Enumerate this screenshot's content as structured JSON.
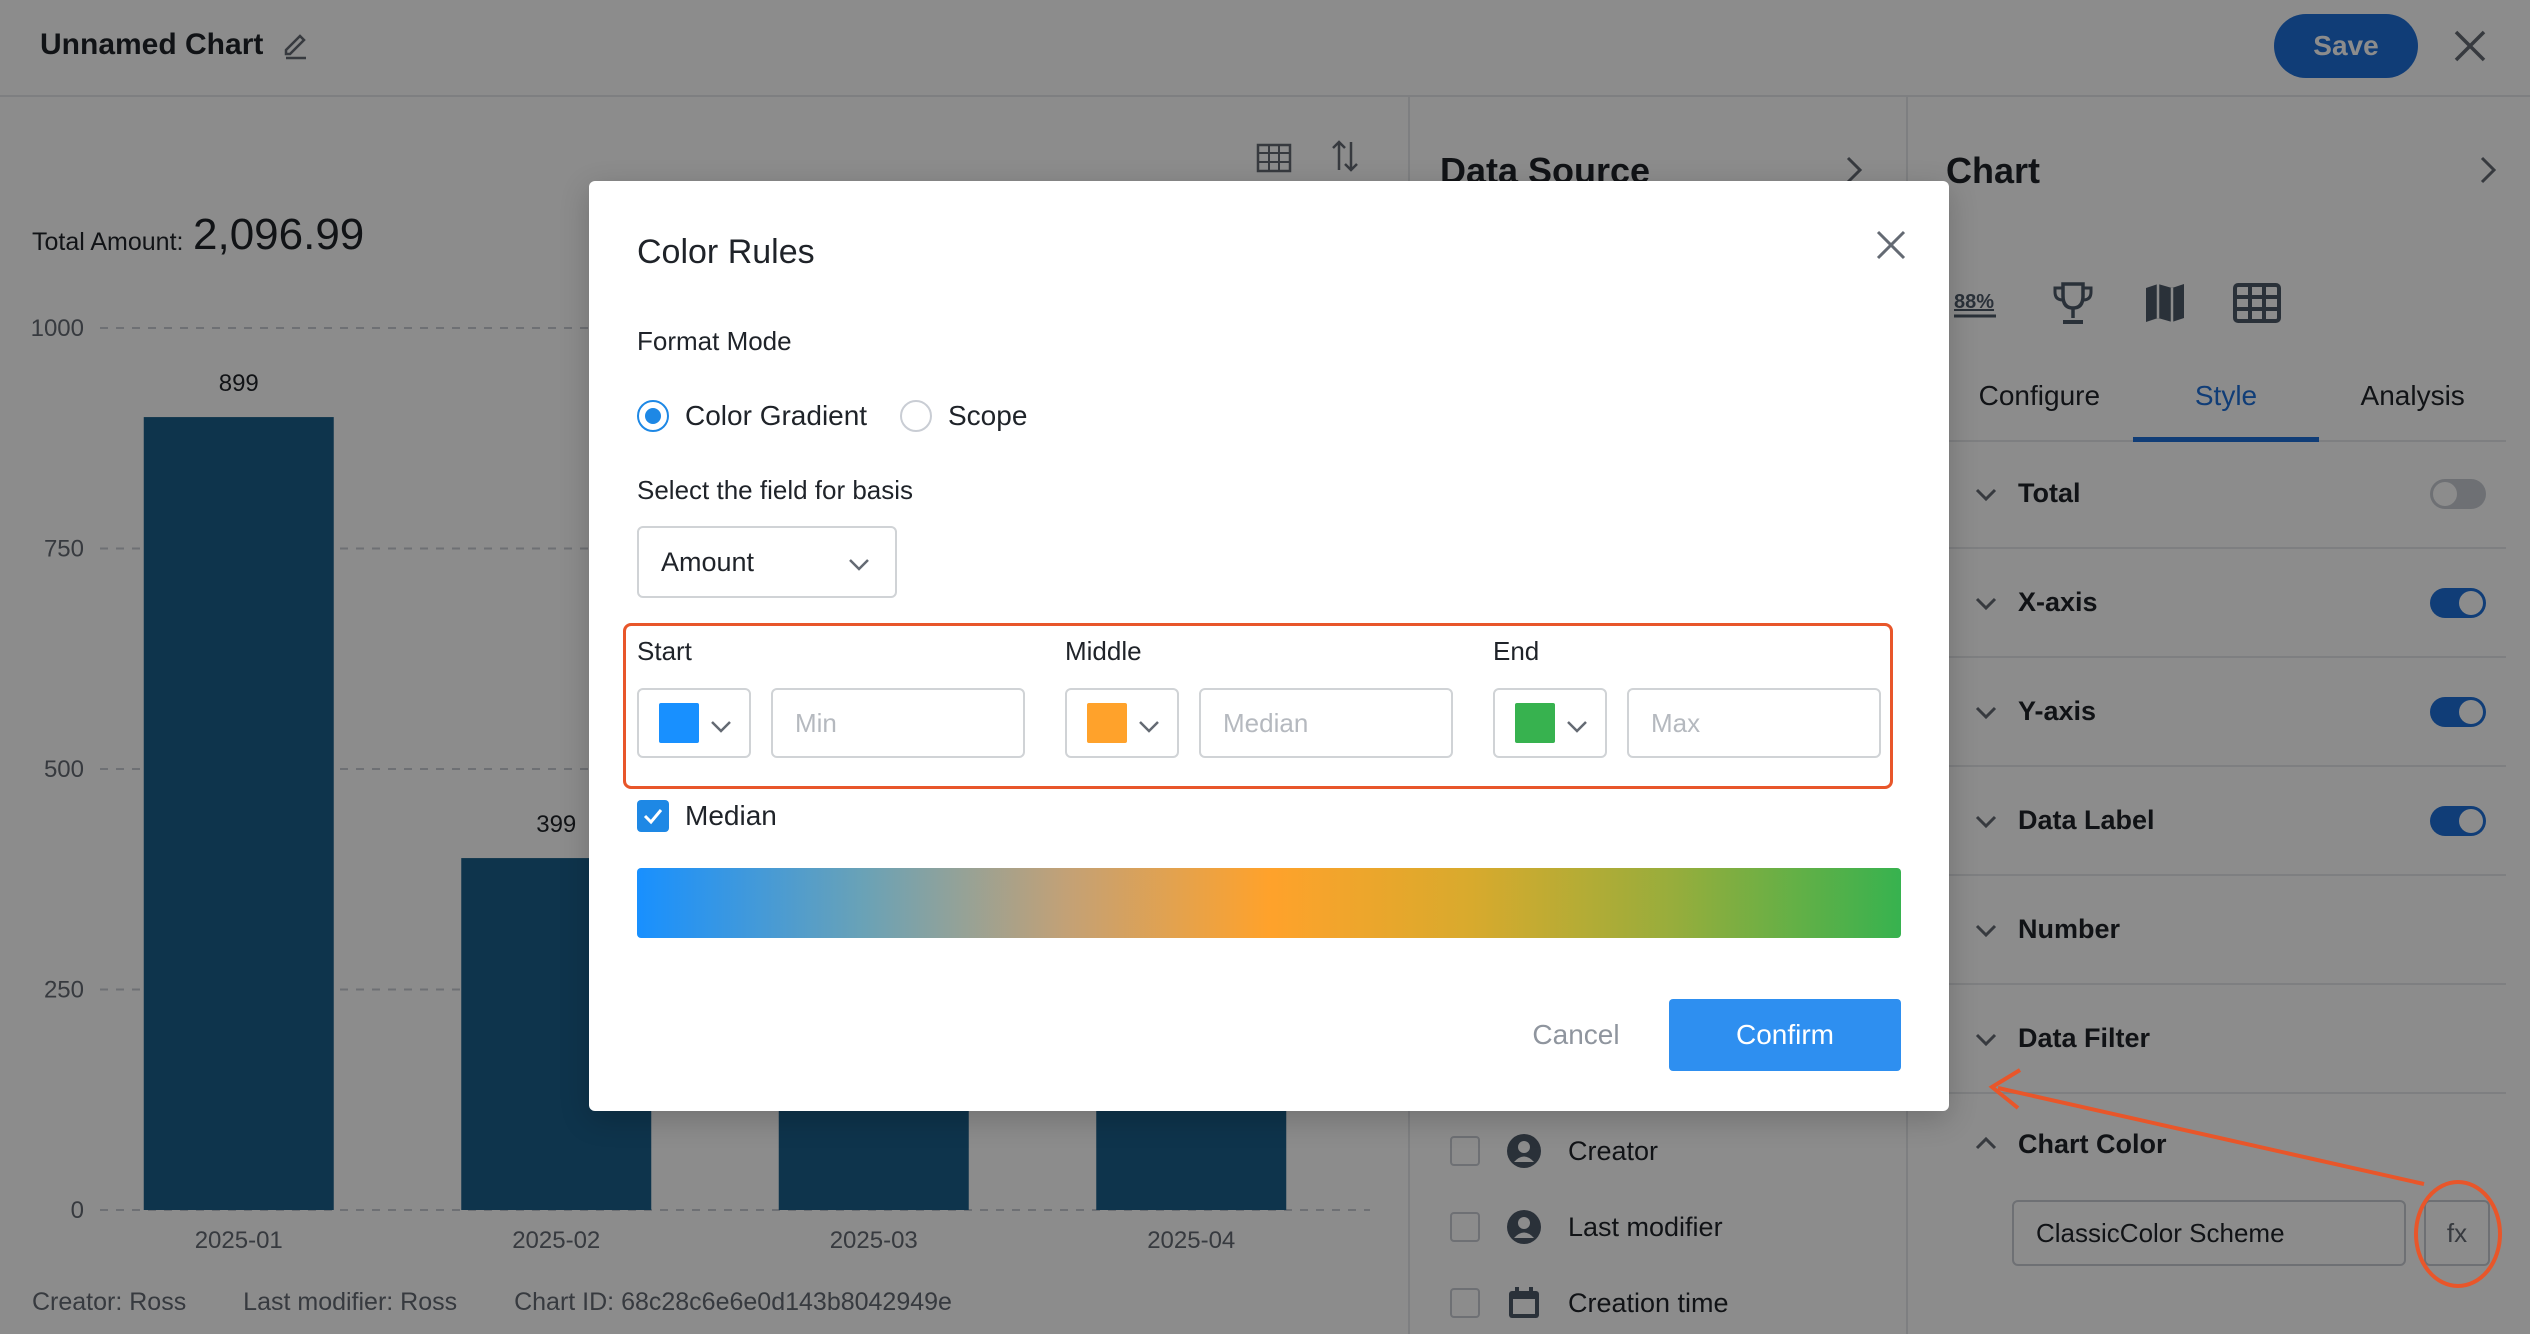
{
  "header": {
    "title": "Unnamed Chart",
    "save_label": "Save"
  },
  "chart_panel": {
    "total_label": "Total Amount:",
    "total_value": "2,096.99",
    "footer": {
      "creator": "Creator: Ross",
      "last_modifier": "Last modifier: Ross",
      "chart_id": "Chart ID: 68c28c6e6e0d143b8042949e"
    }
  },
  "chart_data": {
    "type": "bar",
    "categories": [
      "2025-01",
      "2025-02",
      "2025-03",
      "2025-04"
    ],
    "values": [
      899,
      399,
      400,
      399
    ],
    "data_labels": [
      "899",
      "399",
      "",
      ""
    ],
    "ylim": [
      0,
      1000
    ],
    "yticks": [
      0,
      250,
      500,
      750,
      1000
    ],
    "bar_color": "#1a5f8a",
    "grid": true
  },
  "data_source": {
    "title": "Data Source",
    "fields": [
      {
        "label": "Creator",
        "icon": "user-icon"
      },
      {
        "label": "Last modifier",
        "icon": "user-icon"
      },
      {
        "label": "Creation time",
        "icon": "calendar-icon"
      }
    ]
  },
  "chart_config": {
    "title": "Chart",
    "type_icons": [
      "percent-icon",
      "trophy-icon",
      "map-icon",
      "table-icon"
    ],
    "percent_icon_text": "88%",
    "tabs": [
      "Configure",
      "Style",
      "Analysis"
    ],
    "active_tab": "Style",
    "sections": [
      {
        "label": "Total",
        "toggle": "off"
      },
      {
        "label": "X-axis",
        "toggle": "on"
      },
      {
        "label": "Y-axis",
        "toggle": "on"
      },
      {
        "label": "Data Label",
        "toggle": "on"
      },
      {
        "label": "Number",
        "toggle": null
      },
      {
        "label": "Data Filter",
        "toggle": null
      },
      {
        "label": "Chart Color",
        "toggle": null,
        "expanded": true
      }
    ],
    "color_scheme": "ClassicColor Scheme",
    "fx_label": "fx"
  },
  "modal": {
    "title": "Color Rules",
    "format_mode_label": "Format Mode",
    "modes": [
      {
        "label": "Color Gradient",
        "checked": true
      },
      {
        "label": "Scope",
        "checked": false
      }
    ],
    "basis_label": "Select the field for basis",
    "basis_value": "Amount",
    "stops": [
      {
        "label": "Start",
        "color": "#1890ff",
        "placeholder": "Min"
      },
      {
        "label": "Middle",
        "color": "#ffa22b",
        "placeholder": "Median"
      },
      {
        "label": "End",
        "color": "#37b24f",
        "placeholder": "Max"
      }
    ],
    "median_label": "Median",
    "median_checked": true,
    "cancel_label": "Cancel",
    "confirm_label": "Confirm"
  },
  "colors": {
    "accent": "#1e6fd9",
    "confirm": "#2e8ff0",
    "annotation": "#e8562a"
  }
}
